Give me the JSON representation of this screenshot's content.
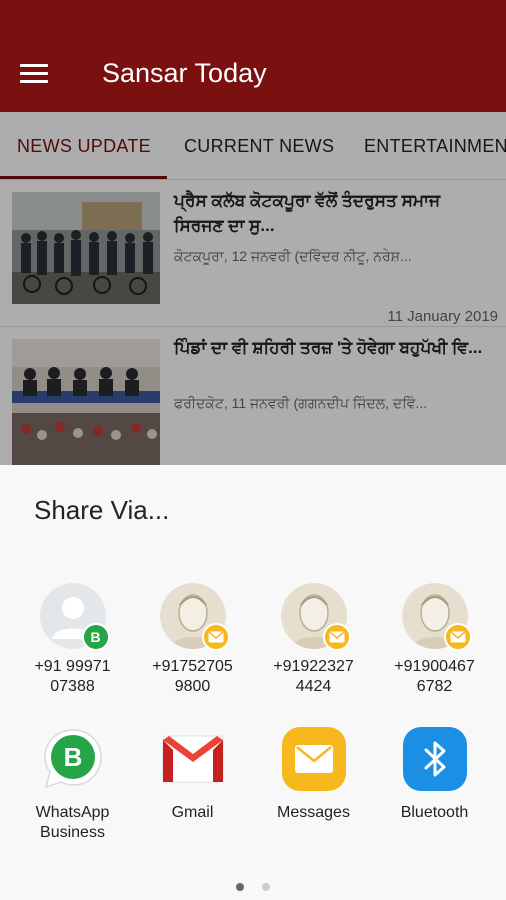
{
  "appbar": {
    "title": "Sansar Today",
    "color": "#7a1010"
  },
  "tabs": [
    {
      "label": "NEWS UPDATE",
      "active": true
    },
    {
      "label": "CURRENT NEWS",
      "active": false
    },
    {
      "label": "ENTERTAINMENT",
      "active": false
    }
  ],
  "news": [
    {
      "title": "ਪ੍ਰੈਸ ਕਲੱਬ ਕੋਟਕਪੂਰਾ ਵੱਲੋਂ ਤੰਦਰੁਸਤ ਸਮਾਜ ਸਿਰਜਣ ਦਾ ਸੁ...",
      "snippet": "ਕੋਟਕਪੂਰਾ, 12 ਜਨਵਰੀ (ਦਵਿੰਦਰ ਨੀਟੂ, ਨਰੇਸ਼...",
      "date": "11 January 2019"
    },
    {
      "title": "ਪਿੰਡਾਂ ਦਾ ਵੀ ਸ਼ਹਿਰੀ ਤਰਜ਼ 'ਤੇ ਹੋਵੇਗਾ ਬਹੁਪੱਖੀ ਵਿ...",
      "snippet": "ਫਰੀਦਕੋਟ, 11 ਜਨਵਰੀ (ਗਗਨਦੀਪ ਜਿੰਦਲ, ਦਵਿੰ...",
      "date": ""
    }
  ],
  "share_sheet": {
    "title": "Share Via...",
    "contacts": [
      {
        "line1": "+91 99971",
        "line2": "07388",
        "badge": "whatsapp-business"
      },
      {
        "line1": "+91752705",
        "line2": "9800",
        "badge": "messages"
      },
      {
        "line1": "+91922327",
        "line2": "4424",
        "badge": "messages"
      },
      {
        "line1": "+91900467",
        "line2": "6782",
        "badge": "messages"
      }
    ],
    "apps": [
      {
        "label": "WhatsApp Business",
        "icon": "whatsapp-business-icon"
      },
      {
        "label": "Gmail",
        "icon": "gmail-icon"
      },
      {
        "label": "Messages",
        "icon": "messages-icon"
      },
      {
        "label": "Bluetooth",
        "icon": "bluetooth-icon"
      }
    ],
    "pages": {
      "current": 1,
      "total": 2
    }
  }
}
